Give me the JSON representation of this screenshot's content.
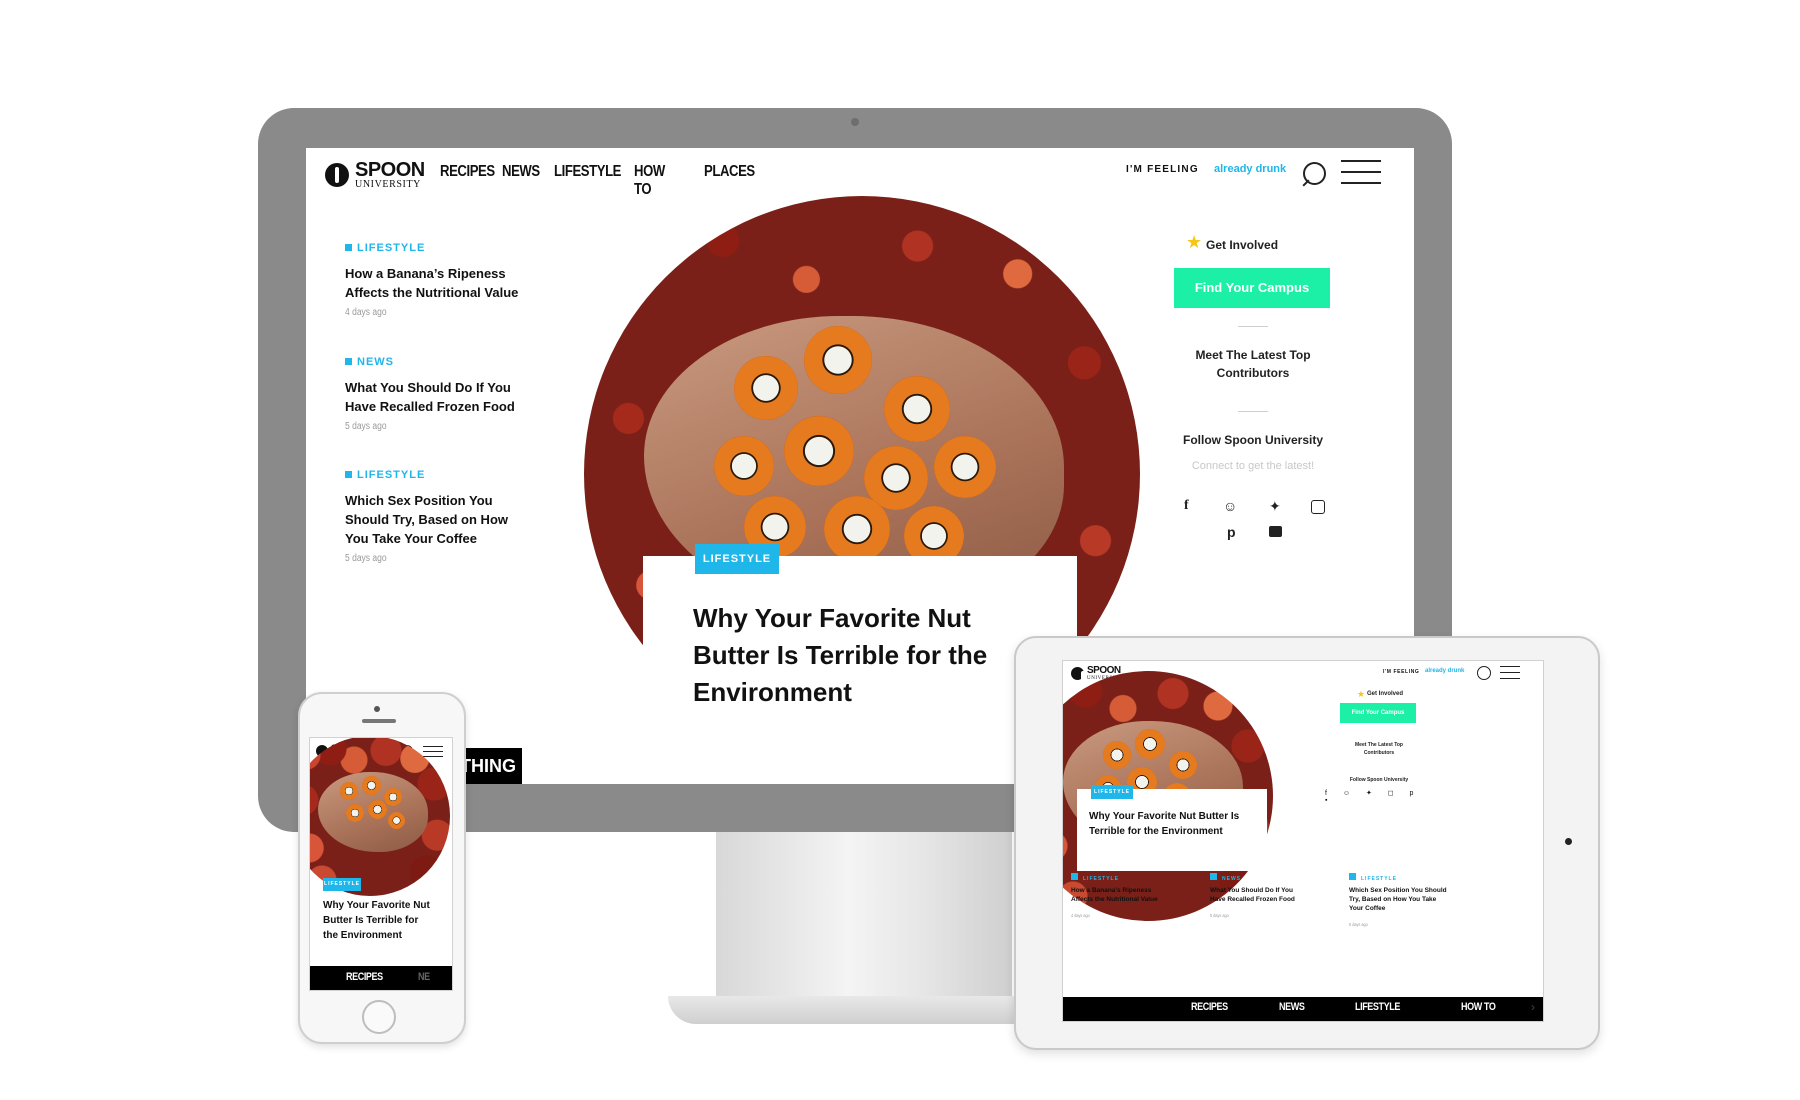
{
  "brand": {
    "name": "SPOON",
    "sub": "UNIVERSITY"
  },
  "nav": {
    "items": [
      "RECIPES",
      "NEWS",
      "LIFESTYLE",
      "HOW TO",
      "PLACES"
    ]
  },
  "feeling": {
    "label": "I'M FEELING",
    "value": "already drunk"
  },
  "stories": [
    {
      "category": "LIFESTYLE",
      "title": "How a Banana’s Ripeness Affects the Nutritional Value",
      "time": "4 days ago"
    },
    {
      "category": "NEWS",
      "title": "What You Should Do If You Have Recalled Frozen Food",
      "time": "5 days ago"
    },
    {
      "category": "LIFESTYLE",
      "title": "Which Sex Position You Should Try, Based on How You Take Your Coffee",
      "time": "5 days ago"
    }
  ],
  "hero": {
    "tag": "LIFESTYLE",
    "title": "Why Your Favorite Nut Butter Is Terrible for the Environment"
  },
  "bottom_banner": "THING",
  "sidebar": {
    "get_involved": "Get Involved",
    "find_campus": "Find Your Campus",
    "top_contributors": "Meet The Latest Top Contributors",
    "follow": "Follow Spoon University",
    "connect": "Connect to get the latest!",
    "socials": [
      "facebook-icon",
      "snapchat-icon",
      "twitter-icon",
      "instagram-icon",
      "pinterest-icon",
      "youtube-icon"
    ]
  },
  "tablet_nav": [
    "RECIPES",
    "NEWS",
    "LIFESTYLE",
    "HOW TO"
  ],
  "tablet_hero_title": "Why Your Favorite Nut Butter Is Terrible for the Environment",
  "phone": {
    "nav_label": "RECIPES",
    "nav_next": "NE",
    "hero_title": "Why Your Favorite Nut Butter Is Terrible for the Environment"
  },
  "colors": {
    "accent": "#1fb6ea",
    "mint": "#1bf0a6",
    "bezel": "#8a8a8a"
  }
}
